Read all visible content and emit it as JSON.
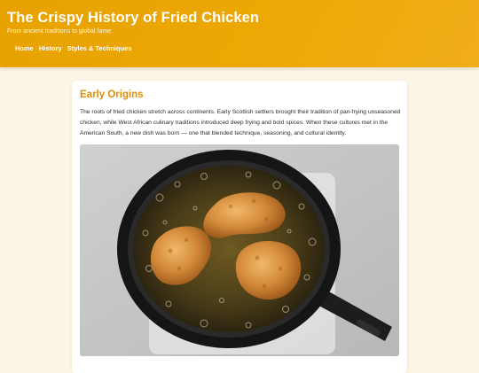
{
  "header": {
    "title": "The Crispy History of Fried Chicken",
    "tagline": "From ancient traditions to global fame."
  },
  "nav": {
    "items": [
      "Home",
      "History",
      "Styles & Techniques"
    ]
  },
  "section": {
    "title": "Early Origins",
    "body": "The roots of fried chicken stretch across continents. Early Scottish settlers brought their tradition of pan-frying unseasoned chicken, while West African culinary traditions introduced deep frying and bold spices. When these cultures met in the American South, a new dish was born — one that blended technique, seasoning, and cultural identity."
  },
  "image": {
    "subject": "fried-chicken-in-cast-iron-skillet"
  },
  "colors": {
    "header": "#eea805",
    "accent": "#dc8f05",
    "background": "#fdf5e4"
  }
}
